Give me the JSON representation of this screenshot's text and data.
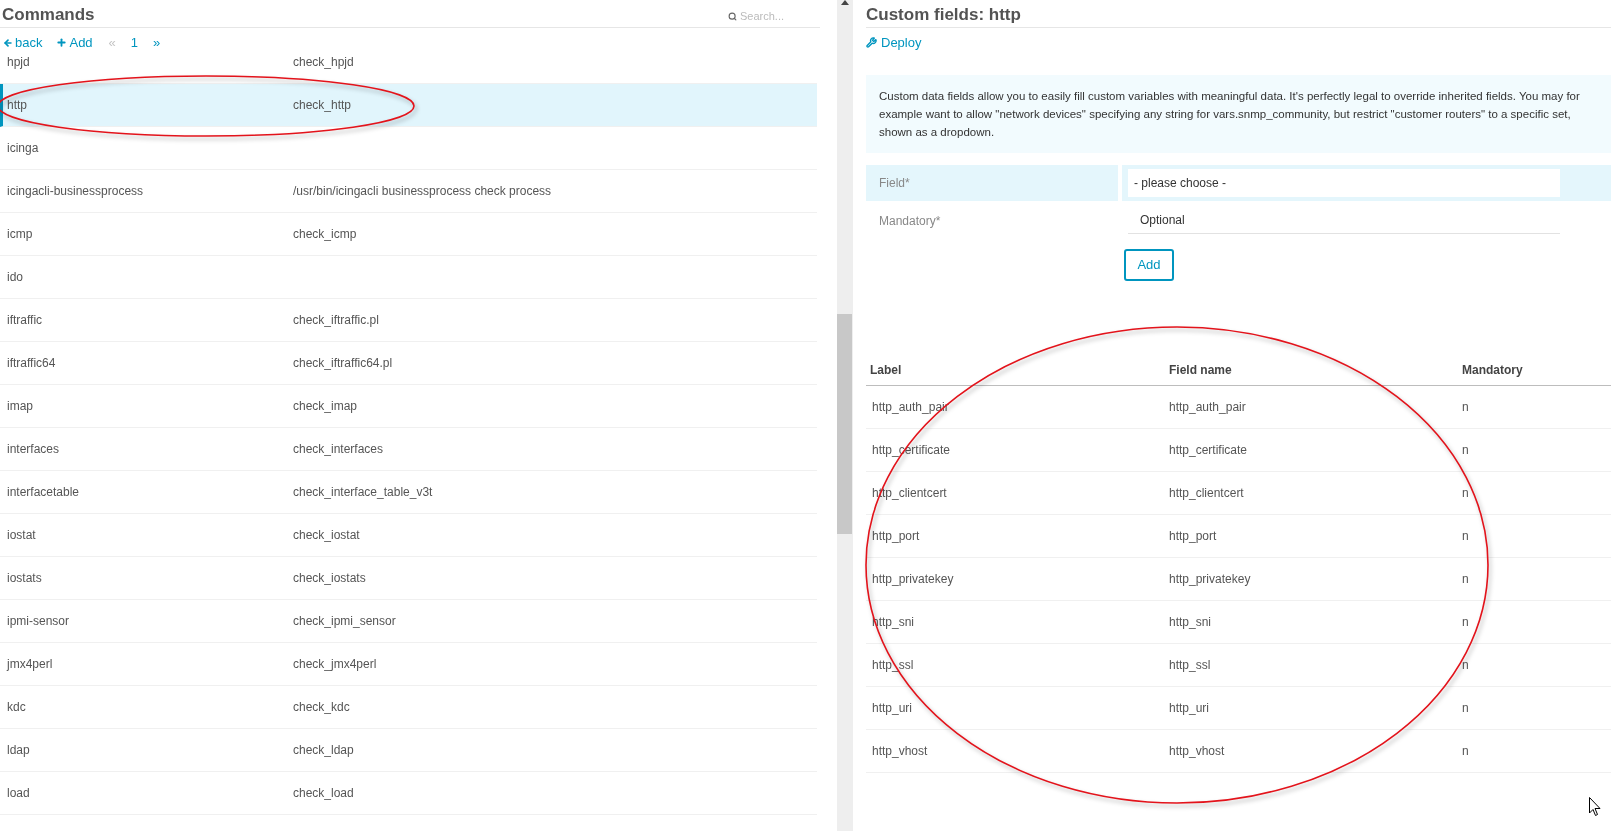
{
  "commands_panel": {
    "title": "Commands",
    "search": {
      "placeholder": "Search..."
    },
    "toolbar": {
      "back": "back",
      "add": "Add",
      "pagination": [
        {
          "label": "«",
          "disabled": true
        },
        {
          "label": "1",
          "disabled": false
        },
        {
          "label": "»",
          "disabled": false
        }
      ]
    },
    "rows": [
      {
        "name": "hpjd",
        "command": "check_hpjd",
        "selected": false
      },
      {
        "name": "http",
        "command": "check_http",
        "selected": true
      },
      {
        "name": "icinga",
        "selected": false
      },
      {
        "name": "icingacli-businessprocess",
        "command": "/usr/bin/icingacli businessprocess check process",
        "selected": false
      },
      {
        "name": "icmp",
        "command": "check_icmp",
        "selected": false
      },
      {
        "name": "ido",
        "selected": false
      },
      {
        "name": "iftraffic",
        "command": "check_iftraffic.pl",
        "selected": false
      },
      {
        "name": "iftraffic64",
        "command": "check_iftraffic64.pl",
        "selected": false
      },
      {
        "name": "imap",
        "command": "check_imap",
        "selected": false
      },
      {
        "name": "interfaces",
        "command": "check_interfaces",
        "selected": false
      },
      {
        "name": "interfacetable",
        "command": "check_interface_table_v3t",
        "selected": false
      },
      {
        "name": "iostat",
        "command": "check_iostat",
        "selected": false
      },
      {
        "name": "iostats",
        "command": "check_iostats",
        "selected": false
      },
      {
        "name": "ipmi-sensor",
        "command": "check_ipmi_sensor",
        "selected": false
      },
      {
        "name": "jmx4perl",
        "command": "check_jmx4perl",
        "selected": false
      },
      {
        "name": "kdc",
        "command": "check_kdc",
        "selected": false
      },
      {
        "name": "ldap",
        "command": "check_ldap",
        "selected": false
      },
      {
        "name": "load",
        "command": "check_load",
        "selected": false
      }
    ]
  },
  "detail_panel": {
    "title": "Custom fields: http",
    "deploy": "Deploy",
    "info": "Custom data fields allow you to easily fill custom variables with meaningful data. It's perfectly legal to override inherited fields. You may for example want to allow \"network devices\" specifying any string for vars.snmp_community, but restrict \"customer routers\" to a specific set, shown as a dropdown.",
    "form": {
      "fields": [
        {
          "label": "Field*",
          "kind": "select",
          "value": "- please choose -",
          "highlighted": true
        },
        {
          "label": "Mandatory*",
          "kind": "text",
          "value": "Optional",
          "highlighted": false
        }
      ],
      "submit": "Add"
    },
    "table": {
      "columns": [
        "Label",
        "Field name",
        "Mandatory"
      ],
      "rows": [
        {
          "label": "http_auth_pair",
          "field_name": "http_auth_pair",
          "mandatory": "n"
        },
        {
          "label": "http_certificate",
          "field_name": "http_certificate",
          "mandatory": "n"
        },
        {
          "label": "http_clientcert",
          "field_name": "http_clientcert",
          "mandatory": "n"
        },
        {
          "label": "http_port",
          "field_name": "http_port",
          "mandatory": "n"
        },
        {
          "label": "http_privatekey",
          "field_name": "http_privatekey",
          "mandatory": "n"
        },
        {
          "label": "http_sni",
          "field_name": "http_sni",
          "mandatory": "n"
        },
        {
          "label": "http_ssl",
          "field_name": "http_ssl",
          "mandatory": "n"
        },
        {
          "label": "http_uri",
          "field_name": "http_uri",
          "mandatory": "n"
        },
        {
          "label": "http_vhost",
          "field_name": "http_vhost",
          "mandatory": "n"
        }
      ]
    }
  }
}
